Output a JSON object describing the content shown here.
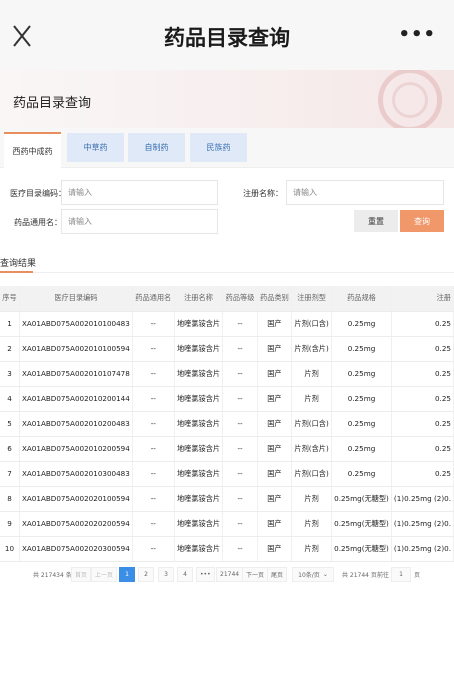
{
  "nav": {
    "title": "药品目录查询",
    "more": "•••",
    "close_icon": "close-icon"
  },
  "banner": {
    "title": "药品目录查询"
  },
  "tabs": [
    {
      "label": "西药中成药",
      "active": true
    },
    {
      "label": "中草药",
      "active": false
    },
    {
      "label": "自制药",
      "active": false
    },
    {
      "label": "民族药",
      "active": false
    }
  ],
  "form": {
    "code_label": "医疗目录编码：",
    "code_placeholder": "请输入",
    "regname_label": "注册名称：",
    "regname_placeholder": "请输入",
    "generic_label": "药品通用名：",
    "generic_placeholder": "请输入",
    "reset_label": "重置",
    "query_label": "查询"
  },
  "results": {
    "label": "查询结果",
    "columns": [
      "序号",
      "医疗目录编码",
      "药品通用名",
      "注册名称",
      "药品等级",
      "药品类别",
      "注册剂型",
      "药品规格",
      "注册"
    ],
    "rows": [
      [
        "1",
        "XA01ABD075A002010100483",
        "--",
        "地喹氯铵含片",
        "--",
        "国产",
        "片剂(口含)",
        "0.25mg",
        "0.25"
      ],
      [
        "2",
        "XA01ABD075A002010100594",
        "--",
        "地喹氯铵含片",
        "--",
        "国产",
        "片剂(含片)",
        "0.25mg",
        "0.25"
      ],
      [
        "3",
        "XA01ABD075A002010107478",
        "--",
        "地喹氯铵含片",
        "--",
        "国产",
        "片剂",
        "0.25mg",
        "0.25"
      ],
      [
        "4",
        "XA01ABD075A002010200144",
        "--",
        "地喹氯铵含片",
        "--",
        "国产",
        "片剂",
        "0.25mg",
        "0.25"
      ],
      [
        "5",
        "XA01ABD075A002010200483",
        "--",
        "地喹氯铵含片",
        "--",
        "国产",
        "片剂(口含)",
        "0.25mg",
        "0.25"
      ],
      [
        "6",
        "XA01ABD075A002010200594",
        "--",
        "地喹氯铵含片",
        "--",
        "国产",
        "片剂(含片)",
        "0.25mg",
        "0.25"
      ],
      [
        "7",
        "XA01ABD075A002010300483",
        "--",
        "地喹氯铵含片",
        "--",
        "国产",
        "片剂(口含)",
        "0.25mg",
        "0.25"
      ],
      [
        "8",
        "XA01ABD075A002020100594",
        "--",
        "地喹氯铵含片",
        "--",
        "国产",
        "片剂",
        "0.25mg(无糖型)",
        "(1)0.25mg (2)0."
      ],
      [
        "9",
        "XA01ABD075A002020200594",
        "--",
        "地喹氯铵含片",
        "--",
        "国产",
        "片剂",
        "0.25mg(无糖型)",
        "(1)0.25mg (2)0."
      ],
      [
        "10",
        "XA01ABD075A002020300594",
        "--",
        "地喹氯铵含片",
        "--",
        "国产",
        "片剂",
        "0.25mg(无糖型)",
        "(1)0.25mg (2)0."
      ]
    ]
  },
  "pager": {
    "total": "共 217434 条",
    "first": "首页",
    "prev": "上一页",
    "pages": [
      "1",
      "2",
      "3",
      "4"
    ],
    "ellipsis": "•••",
    "last_page": "21744",
    "next": "下一页",
    "end": "尾页",
    "per_page": "10条/页",
    "total_pages": "共 21744 页",
    "goto": "前往",
    "goto_value": "1",
    "page_unit": "页"
  },
  "colors": {
    "accent": "#e98f5f",
    "query_button": "#f0986a",
    "tab_inactive": "#dfe9f7",
    "page_current": "#3a8ee6"
  }
}
